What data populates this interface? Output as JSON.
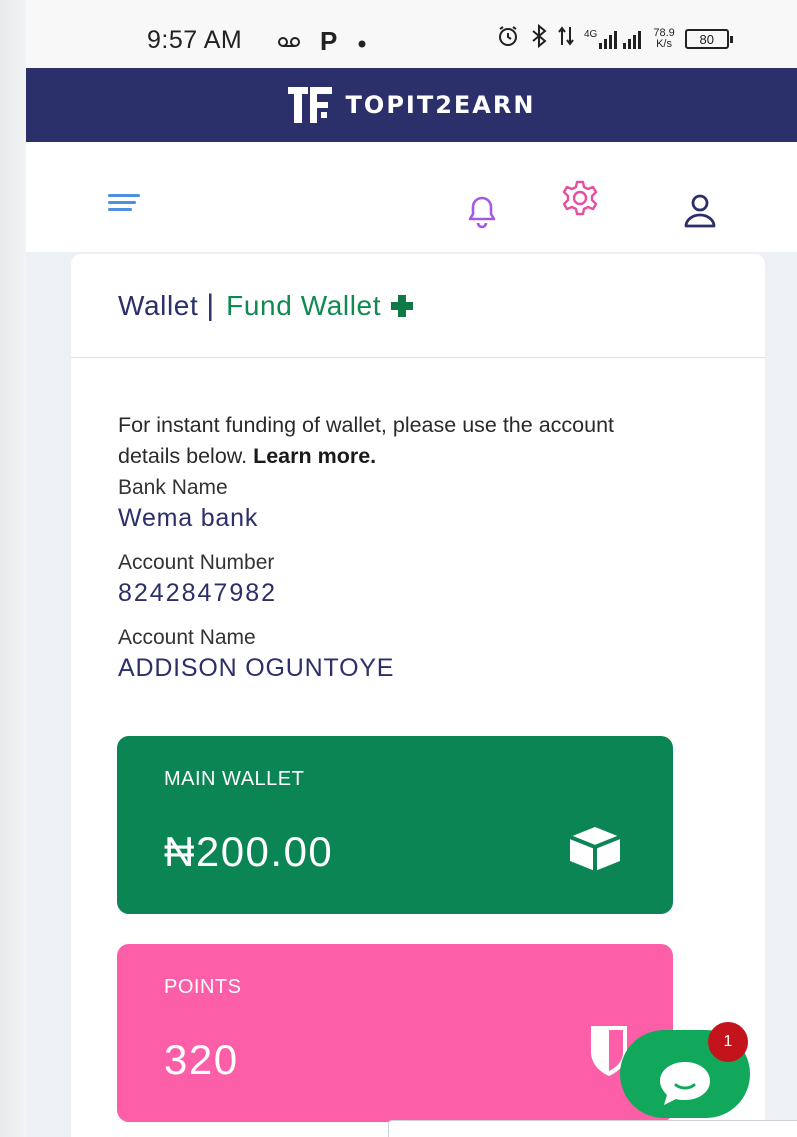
{
  "status_bar": {
    "time": "9:57 AM",
    "left_icons": [
      "voicemail-icon",
      "parking-icon",
      "dot-icon"
    ],
    "p_glyph": "P",
    "network": "4G",
    "speed_value": "78.9",
    "speed_unit": "K/s",
    "battery": "80"
  },
  "brand": {
    "name": "TOPIT2EARN"
  },
  "nav": {
    "icons": [
      "menu-icon",
      "bell-icon",
      "gear-icon",
      "user-icon"
    ],
    "colors": {
      "menu": "#4d8fe0",
      "bell": "#a259e6",
      "gear": "#e94fa0",
      "user": "#2b2f6a"
    }
  },
  "wallet_card": {
    "tab_wallet": "Wallet",
    "tab_separator": "|",
    "tab_fund": "Fund Wallet",
    "intro_text": "For instant funding of wallet, please use the account details below. ",
    "intro_link": "Learn more.",
    "bank_name_label": "Bank Name",
    "bank_name": "Wema bank",
    "account_number_label": "Account Number",
    "account_number": "8242847982",
    "account_name_label": "Account Name",
    "account_name": "ADDISON OGUNTOYE"
  },
  "main_wallet": {
    "label": "MAIN WALLET",
    "amount": "₦200.00",
    "color": "#0a8553"
  },
  "points": {
    "label": "POINTS",
    "value": "320",
    "color": "#fc5fa8"
  },
  "chat": {
    "badge_count": "1",
    "color": "#11a85b"
  }
}
